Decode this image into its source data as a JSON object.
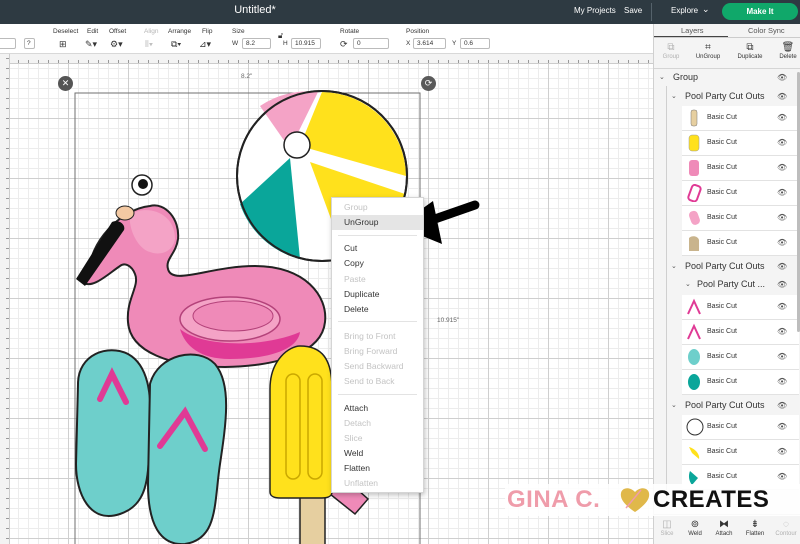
{
  "topbar": {
    "title": "Untitled*",
    "my_projects": "My Projects",
    "save": "Save",
    "explore": "Explore",
    "make_it": "Make It"
  },
  "toolbar": {
    "deselect": "Deselect",
    "edit": "Edit",
    "offset": "Offset",
    "align": "Align",
    "arrange": "Arrange",
    "flip": "Flip",
    "size": "Size",
    "w_label": "W",
    "w_value": "8.2",
    "h_label": "H",
    "h_value": "10.915",
    "rotate": "Rotate",
    "rotate_value": "0",
    "position": "Position",
    "x_label": "X",
    "x_value": "3.614",
    "y_label": "Y",
    "y_value": "0.6",
    "help": "?"
  },
  "canvas": {
    "width_label": "8.2\"",
    "height_label": "10.915\""
  },
  "context_menu": {
    "items": [
      {
        "label": "Group",
        "enabled": false
      },
      {
        "label": "UnGroup",
        "enabled": true,
        "highlighted": true
      },
      {
        "label": "Cut",
        "enabled": true
      },
      {
        "label": "Copy",
        "enabled": true
      },
      {
        "label": "Paste",
        "enabled": false
      },
      {
        "label": "Duplicate",
        "enabled": true
      },
      {
        "label": "Delete",
        "enabled": true
      },
      {
        "label": "Bring to Front",
        "enabled": false
      },
      {
        "label": "Bring Forward",
        "enabled": false
      },
      {
        "label": "Send Backward",
        "enabled": false
      },
      {
        "label": "Send to Back",
        "enabled": false
      },
      {
        "label": "Attach",
        "enabled": true
      },
      {
        "label": "Detach",
        "enabled": false
      },
      {
        "label": "Slice",
        "enabled": false
      },
      {
        "label": "Weld",
        "enabled": true
      },
      {
        "label": "Flatten",
        "enabled": true
      },
      {
        "label": "Unflatten",
        "enabled": false
      }
    ]
  },
  "panel": {
    "tabs": [
      "Layers",
      "Color Sync"
    ],
    "tools": [
      {
        "label": "Group",
        "enabled": false
      },
      {
        "label": "UnGroup",
        "enabled": true
      },
      {
        "label": "Duplicate",
        "enabled": true
      },
      {
        "label": "Delete",
        "enabled": true
      }
    ],
    "group_label": "Group",
    "subgroups": [
      {
        "label": "Pool Party Cut Outs"
      },
      {
        "label": "Pool Party Cut Outs"
      },
      {
        "label": "Pool Party Cut ..."
      },
      {
        "label": "Pool Party Cut Outs"
      }
    ],
    "layer_label": "Basic Cut",
    "colors": {
      "tan": "#e6cfa0",
      "yellow": "#ffe11c",
      "pink": "#ef8ab8",
      "hot_pink": "#e03a95",
      "light_pink": "#f4a3c6",
      "beige": "#c9b48d",
      "teal_light": "#6ecfcb",
      "teal": "#0aa69a",
      "white": "#ffffff"
    },
    "bottom_tools": [
      {
        "label": "Slice",
        "enabled": false
      },
      {
        "label": "Weld",
        "enabled": true
      },
      {
        "label": "Attach",
        "enabled": true
      },
      {
        "label": "Flatten",
        "enabled": true
      },
      {
        "label": "Contour",
        "enabled": false
      }
    ]
  },
  "watermark": {
    "left": "GINA C.",
    "right": "CREATES"
  }
}
